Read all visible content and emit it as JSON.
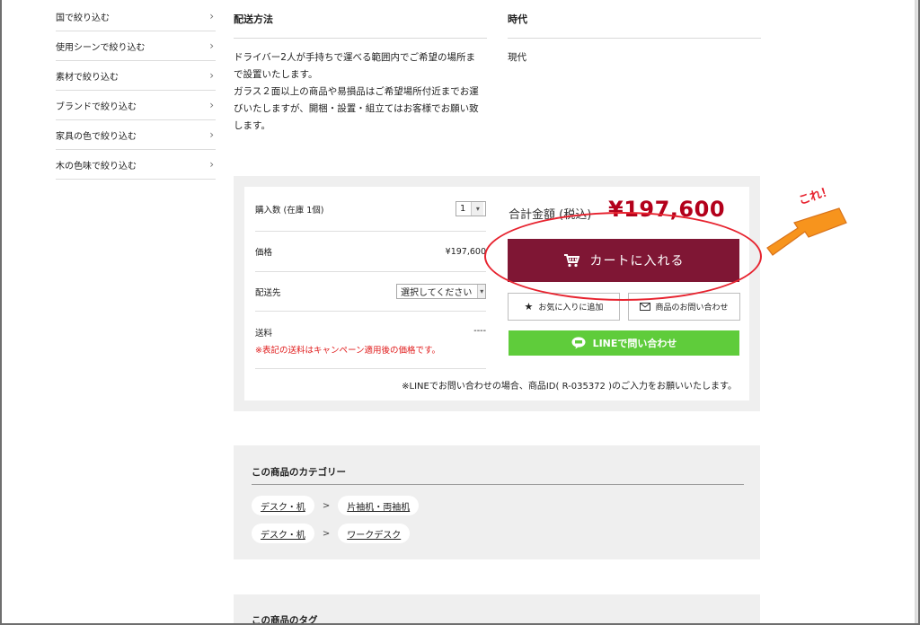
{
  "sidebar": {
    "items": [
      {
        "label": "国で絞り込む"
      },
      {
        "label": "使用シーンで絞り込む"
      },
      {
        "label": "素材で絞り込む"
      },
      {
        "label": "ブランドで絞り込む"
      },
      {
        "label": "家具の色で絞り込む"
      },
      {
        "label": "木の色味で絞り込む"
      }
    ],
    "chevron": "›"
  },
  "shipping": {
    "heading": "配送方法",
    "lines": [
      "ドライバー2人が手持ちで運べる範囲内でご希望の場所ま",
      "で設置いたします。",
      "ガラス２面以上の商品や易損品はご希望場所付近までお運",
      "びいたしますが、開梱・設置・組立てはお客様でお願い致",
      "します。"
    ]
  },
  "era": {
    "heading": "時代",
    "value": "現代"
  },
  "purchase": {
    "quantity_label": "購入数 (在庫 1個)",
    "quantity_value": "1",
    "price_label": "価格",
    "price_value": "¥197,600",
    "destination_label": "配送先",
    "destination_value": "選択してください",
    "shipping_label": "送料",
    "shipping_value": "----",
    "shipping_note": "※表記の送料はキャンペーン適用後の価格です。",
    "total_label": "合計金額 (税込)",
    "total_value": "¥197,600",
    "cart_label": "カートに入れる",
    "favorite_label": "お気に入りに追加",
    "inquiry_label": "商品のお問い合わせ",
    "line_label": "LINEで問い合わせ",
    "line_note": "※LINEでお問い合わせの場合、商品ID( R-035372 )のご入力をお願いいたします。"
  },
  "categories": {
    "title": "この商品のカテゴリー",
    "separator": ">",
    "rows": [
      {
        "parent": "デスク・机",
        "child": "片袖机・両袖机"
      },
      {
        "parent": "デスク・机",
        "child": "ワークデスク"
      }
    ]
  },
  "tags": {
    "title": "この商品のタグ"
  },
  "annotation": {
    "text": "これ！"
  },
  "colors": {
    "cart_button": "#7f1634",
    "line_button": "#5fcc3b",
    "price": "#b3001b",
    "annotation": "#e7232f",
    "arrow": "#f7941d"
  },
  "icons": {
    "cart": "cart-icon",
    "star": "star-icon",
    "mail": "mail-icon",
    "line": "line-logo-icon"
  }
}
